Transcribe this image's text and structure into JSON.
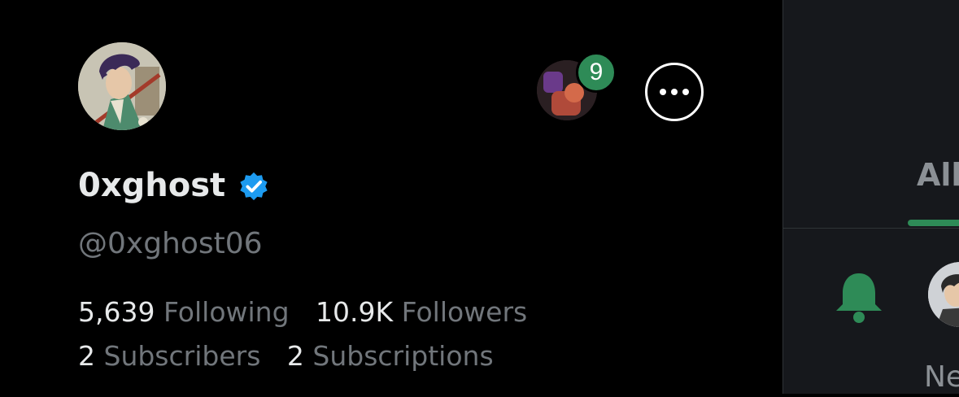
{
  "profile": {
    "display_name": "0xghost",
    "handle": "@0xghost06",
    "verified": true,
    "avatar": "anime-character-avatar"
  },
  "header": {
    "drafts_count": "9",
    "more_icon": "ellipsis-icon"
  },
  "stats": {
    "following_count": "5,639",
    "following_label": "Following",
    "followers_count": "10.9K",
    "followers_label": "Followers",
    "subscribers_count": "2",
    "subscribers_label": "Subscribers",
    "subscriptions_count": "2",
    "subscriptions_label": "Subscriptions"
  },
  "side_panel": {
    "tab_label": "All",
    "notification_text": "Ne",
    "bell_icon": "bell-icon"
  },
  "colors": {
    "background": "#000000",
    "panel_background": "#16181c",
    "accent_green": "#2e8b57",
    "verified_blue": "#1d9bf0",
    "secondary_text": "#71767b",
    "primary_text": "#e7e9ea"
  }
}
